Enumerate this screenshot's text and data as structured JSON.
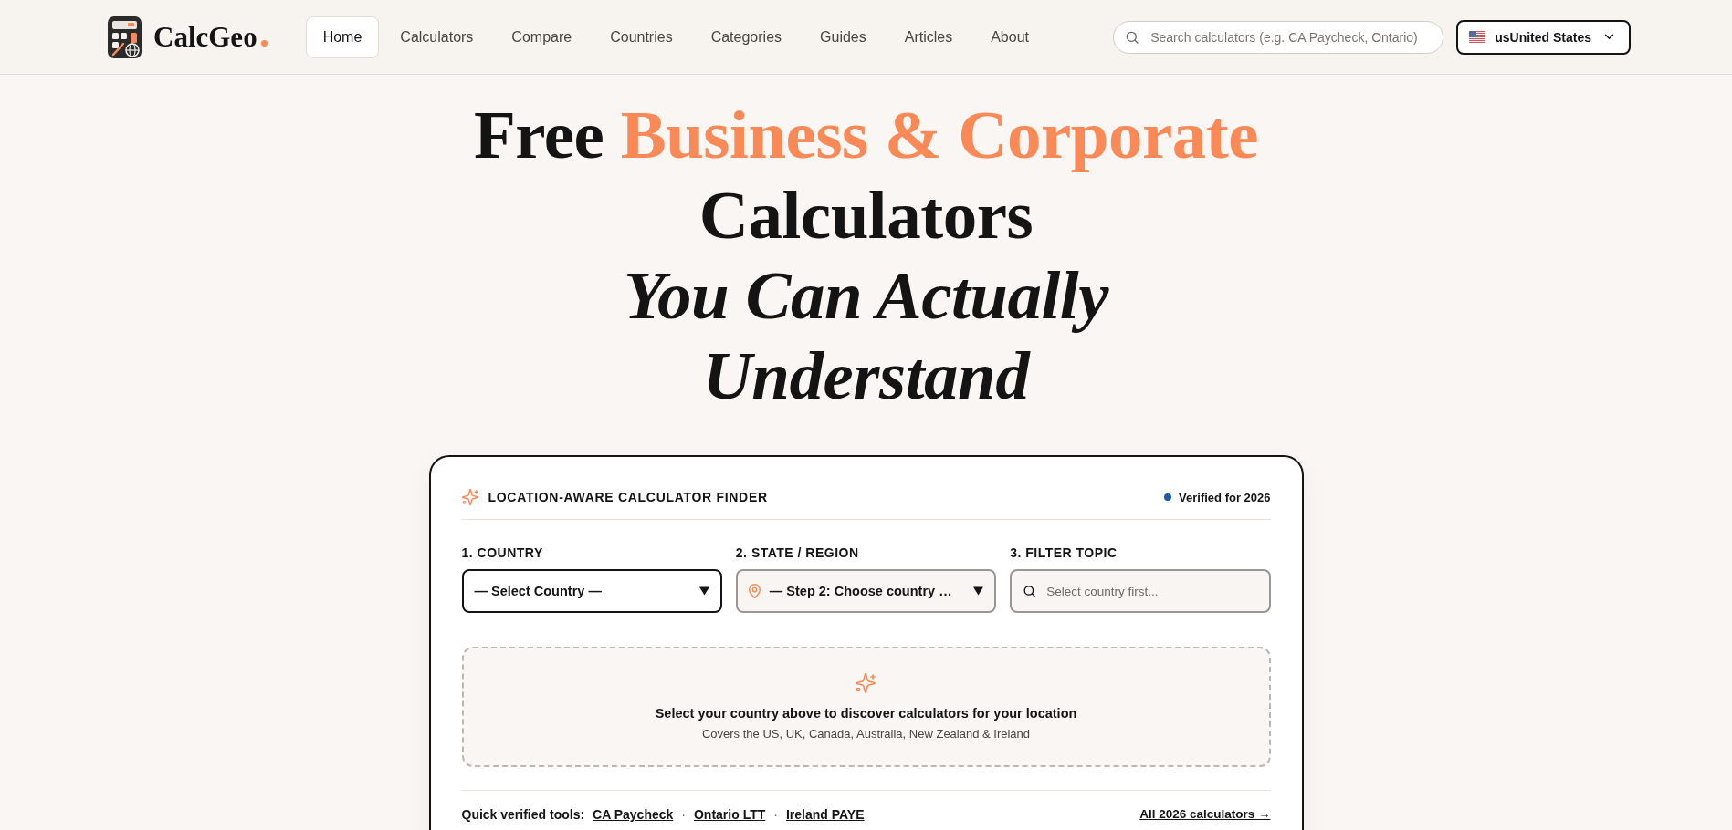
{
  "header": {
    "brand": "CalcGeo",
    "nav": [
      {
        "label": "Home",
        "selected": true
      },
      {
        "label": "Calculators",
        "selected": false
      },
      {
        "label": "Compare",
        "selected": false
      },
      {
        "label": "Countries",
        "selected": false
      },
      {
        "label": "Categories",
        "selected": false
      },
      {
        "label": "Guides",
        "selected": false
      },
      {
        "label": "Articles",
        "selected": false
      },
      {
        "label": "About",
        "selected": false
      }
    ],
    "search": {
      "placeholder": "Search calculators (e.g. CA Paycheck, Ontario)"
    },
    "country_button": {
      "label": "usUnited States"
    }
  },
  "hero": {
    "heading": [
      {
        "kind": "plain",
        "text": "Free"
      },
      {
        "kind": "accent",
        "text": "Business & Corporate"
      },
      {
        "kind": "plain",
        "text": "Calculators"
      },
      {
        "kind": "emphasis",
        "text": "You Can Actually Understand"
      }
    ]
  },
  "finder": {
    "title": "LOCATION-AWARE CALCULATOR FINDER",
    "badge": "Verified for 2026",
    "fields": [
      {
        "kind": "select",
        "label": "1. COUNTRY",
        "value": "— Select Country —",
        "disabled": false
      },
      {
        "kind": "location-select",
        "label": "2. STATE / REGION",
        "value": "— Step 2: Choose country …",
        "disabled": true
      },
      {
        "kind": "search",
        "label": "3. FILTER TOPIC",
        "placeholder": "Select country first...",
        "disabled": true
      }
    ],
    "empty_state": {
      "title": "Select your country above to discover calculators for your location",
      "subtitle": "Covers the US, UK, Canada, Australia, New Zealand & Ireland"
    },
    "quick_tools": {
      "label": "Quick verified tools:",
      "separator": "·",
      "links": [
        "CA Paycheck",
        "Ontario LTT",
        "Ireland PAYE"
      ],
      "all_link": "All 2026 calculators →"
    }
  }
}
